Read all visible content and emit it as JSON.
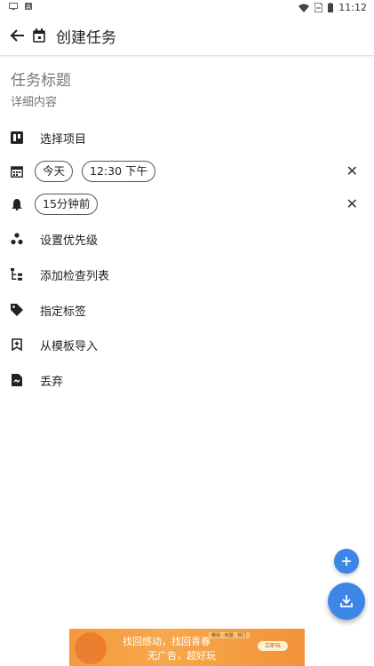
{
  "status_bar": {
    "time": "11:12",
    "left_icons": [
      "screen-icon",
      "a-icon"
    ],
    "right_icons": [
      "wifi-icon",
      "sim-icon",
      "battery-icon"
    ]
  },
  "appbar": {
    "title": "创建任务",
    "back_icon": "arrow-left-icon",
    "calendar_icon": "calendar-icon"
  },
  "task": {
    "title_placeholder": "任务标题",
    "detail_placeholder": "详细内容"
  },
  "rows": {
    "project": "选择项目",
    "date_chip": "今天",
    "time_chip": "12:30 下午",
    "reminder_chip": "15分钟前",
    "priority": "设置优先级",
    "checklist": "添加检查列表",
    "tag": "指定标签",
    "template": "从模板导入",
    "discard": "丢弃"
  },
  "ad": {
    "line1": "找回感动，找回青春",
    "line2": "无广告，超好玩",
    "small_text": "畅快 · 刺激 · 热门",
    "button": "立即玩"
  },
  "colors": {
    "accent": "#3d86e8",
    "ad": "#f39a3d"
  }
}
